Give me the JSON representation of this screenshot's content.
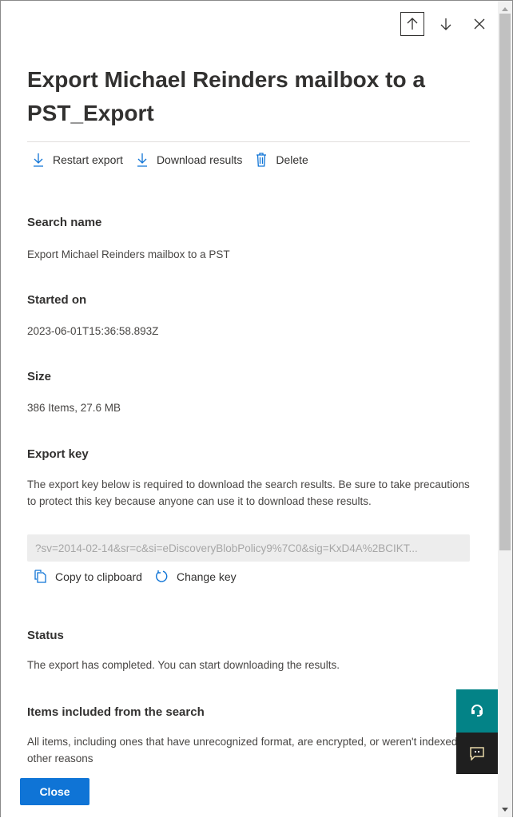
{
  "nav": {
    "up_icon": "arrow-up-icon",
    "down_icon": "arrow-down-icon",
    "close_icon": "close-icon"
  },
  "title": "Export Michael Reinders mailbox to a PST_Export",
  "toolbar": {
    "restart_label": "Restart export",
    "download_label": "Download results",
    "delete_label": "Delete"
  },
  "details": {
    "search_name": {
      "label": "Search name",
      "value": "Export Michael Reinders mailbox to a PST"
    },
    "started_on": {
      "label": "Started on",
      "value": "2023-06-01T15:36:58.893Z"
    },
    "size": {
      "label": "Size",
      "value": "386 Items, 27.6 MB"
    },
    "export_key": {
      "label": "Export key",
      "description": "The export key below is required to download the search results. Be sure to take precautions to protect this key because anyone can use it to download these results.",
      "value": "?sv=2014-02-14&sr=c&si=eDiscoveryBlobPolicy9%7C0&sig=KxD4A%2BCIKT...",
      "copy_label": "Copy to clipboard",
      "change_label": "Change key"
    },
    "status": {
      "label": "Status",
      "value": "The export has completed. You can start downloading the results."
    },
    "items_included": {
      "label": "Items included from the search",
      "value": "All items, including ones that have unrecognized format, are encrypted, or weren't indexed for other reasons"
    }
  },
  "footer": {
    "close_label": "Close"
  },
  "colors": {
    "accent": "#0f74d6",
    "help": "#038387",
    "feedback": "#1f1f1f"
  }
}
